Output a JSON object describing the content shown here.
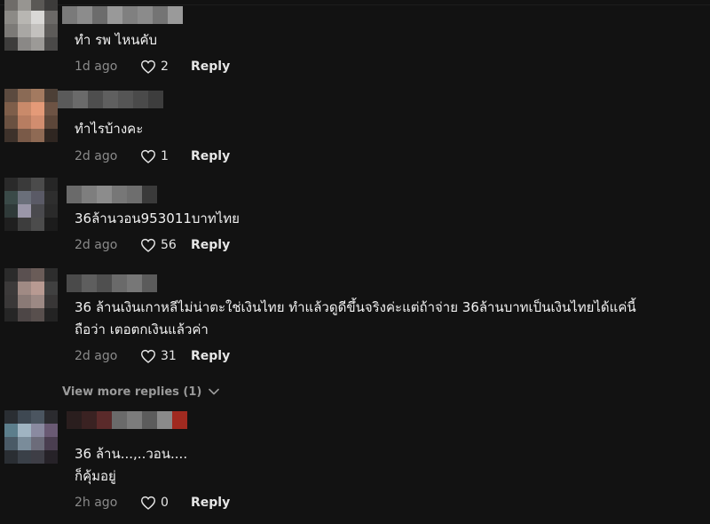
{
  "comments": [
    {
      "text_lines": [
        "ทำ รพ ไหนคับ"
      ],
      "time": "1d ago",
      "likes": "2",
      "reply_label": "Reply",
      "avatar_colors": [
        "#6f6c69",
        "#979591",
        "#5a5855",
        "#3c3b3a",
        "#8c8a86",
        "#b8b6b2",
        "#d9d8d6",
        "#6b6967",
        "#7c7a77",
        "#a9a7a4",
        "#c3c1be",
        "#5d5b59",
        "#3e3d3c",
        "#8a8886",
        "#9c9a97",
        "#4a4948"
      ],
      "username_colors": [
        "#7a7a7a",
        "#8c8c8c",
        "#6c6c6c",
        "#999999",
        "#808080",
        "#8b8b8b",
        "#747474",
        "#9a9a9a"
      ]
    },
    {
      "text_lines": [
        "ทำไรบ้างคะ"
      ],
      "time": "2d ago",
      "likes": "1",
      "reply_label": "Reply",
      "avatar_colors": [
        "#5b4a3f",
        "#8a6a55",
        "#a37a60",
        "#4c3f36",
        "#7e5e4a",
        "#c98a6a",
        "#e49a78",
        "#6d5344",
        "#6a5141",
        "#b77d61",
        "#d18d6f",
        "#5c4639",
        "#3e322b",
        "#7a5a48",
        "#8f6a54",
        "#2f2621"
      ],
      "username_colors": [
        "#5a5a5a",
        "#6a6a6a",
        "#4e4e4e",
        "#5f5f5f",
        "#555555",
        "#4a4a4a",
        "#3d3d3d"
      ]
    },
    {
      "text_lines": [
        "36ล้านวอน953011บาทไทย"
      ],
      "time": "2d ago",
      "likes": "56",
      "reply_label": "Reply",
      "avatar_colors": [
        "#2a2a2a",
        "#3a3a3a",
        "#4b4b4b",
        "#262626",
        "#3a4a48",
        "#6a6f7a",
        "#5a5a66",
        "#2e2e2e",
        "#2f3a39",
        "#9a96a8",
        "#4a4a4e",
        "#2a2a2a",
        "#1f1f1f",
        "#3d3d3d",
        "#4c4c4c",
        "#1c1c1c"
      ],
      "username_colors": [
        "#6a6a6a",
        "#7e7e7e",
        "#8c8c8c",
        "#777777",
        "#6e6e6e",
        "#3a3a3a"
      ]
    },
    {
      "text_lines": [
        "36 ล้านเงินเกาหลีไม่น่าตะใช่เงินไทย ทำแล้วดูดีขึ้นจริงค่ะแต่ถ้าจ่าย 36ล้านบาทเป็นเงินไทยได้แค่นี้",
        "ถือว่า เตอตกเงินแล้วค่า"
      ],
      "time": "2d ago",
      "likes": "31",
      "reply_label": "Reply",
      "avatar_colors": [
        "#2b2b2b",
        "#5a5050",
        "#6a5c58",
        "#2d2d2d",
        "#3c3a3a",
        "#a08a84",
        "#b89a92",
        "#404040",
        "#3a3838",
        "#8a7a76",
        "#9c8984",
        "#383636",
        "#262626",
        "#4d4646",
        "#584f4d",
        "#232323"
      ],
      "username_colors": [
        "#4a4a4a",
        "#5e5e5e",
        "#4f4f4f",
        "#6a6a6a",
        "#777777",
        "#5b5b5b"
      ]
    },
    {
      "text_lines": [
        "36 ล้าน...,..วอน....",
        "ก็คุ้มอยู่"
      ],
      "time": "2h ago",
      "likes": "0",
      "reply_label": "Reply",
      "avatar_colors": [
        "#2a2e33",
        "#3e4852",
        "#4b5560",
        "#2b2b2f",
        "#5c7e8c",
        "#a0b4c2",
        "#8a8aa0",
        "#6a5a74",
        "#4a5a66",
        "#7a8c9a",
        "#6c6c7a",
        "#4a3e50",
        "#2a2e33",
        "#3a4048",
        "#3e3e46",
        "#262228"
      ],
      "username_colors": [
        "#2a1e1e",
        "#3a2222",
        "#5a2a2a",
        "#6a6a6a",
        "#7c7c7c",
        "#5c5c5c",
        "#8a8a8a",
        "#a02a20"
      ]
    }
  ],
  "view_more": {
    "label": "View more replies (1)"
  }
}
